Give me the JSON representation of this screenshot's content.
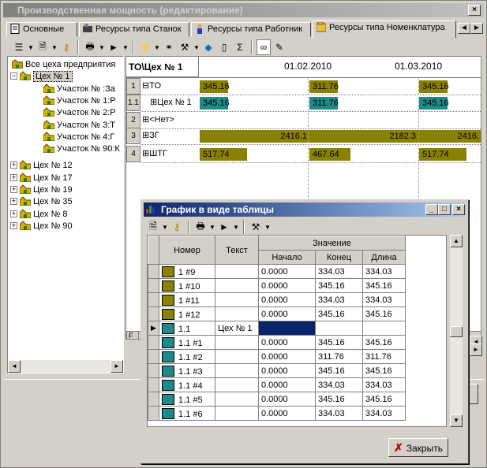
{
  "main_window": {
    "title": "Производственная мощность (редактирование)",
    "close": "×"
  },
  "tabs": [
    {
      "label": "Основные",
      "icon": "document-icon"
    },
    {
      "label": "Ресурсы типа Станок",
      "icon": "machine-icon"
    },
    {
      "label": "Ресурсы типа Работник",
      "icon": "worker-icon"
    },
    {
      "label": "Ресурсы типа Номенклатура",
      "icon": "nomenclature-icon"
    }
  ],
  "tree": {
    "root": "Все цеха предприятия",
    "items": [
      {
        "label": "Цех № 1",
        "selected": true,
        "expanded": true
      },
      {
        "label": "Участок № :За"
      },
      {
        "label": "Участок № 1:Р"
      },
      {
        "label": "Участок № 2:Р"
      },
      {
        "label": "Участок № 3:Т"
      },
      {
        "label": "Участок № 4:Г"
      },
      {
        "label": "Участок № 90:К"
      },
      {
        "label": "Цех № 12"
      },
      {
        "label": "Цех № 17"
      },
      {
        "label": "Цех № 19"
      },
      {
        "label": "Цех № 35"
      },
      {
        "label": "Цех № 8"
      },
      {
        "label": "Цех № 90"
      }
    ]
  },
  "gantt": {
    "header_label": "ТО\\Цех № 1",
    "dates": [
      "01.02.2010",
      "01.03.2010"
    ],
    "rows": [
      {
        "num": "1",
        "label": "ТО",
        "values": [
          "345.16",
          "311.76",
          "345.16"
        ]
      },
      {
        "num": "1.1",
        "label": "Цех № 1",
        "values": [
          "345.16",
          "311.76",
          "345.16"
        ]
      },
      {
        "num": "2",
        "label": "<Нет>",
        "values": []
      },
      {
        "num": "3",
        "label": "ЗГ",
        "values": [
          "2416.1",
          "2182.3",
          "2416."
        ]
      },
      {
        "num": "4",
        "label": "ШТГ",
        "values": [
          "517.74",
          "467.64",
          "517.74"
        ]
      }
    ],
    "colors": {
      "olive": "#8b8100",
      "teal": "#1e8a8a"
    },
    "tab_stub": "F"
  },
  "dialog": {
    "title": "График в виде таблицы",
    "columns": {
      "num": "Номер",
      "text": "Текст",
      "value_group": "Значение",
      "start": "Начало",
      "end": "Конец",
      "length": "Длина"
    },
    "rows": [
      {
        "num": "1 #9",
        "text": "",
        "start": "0.0000",
        "end": "334.03",
        "len": "334.03",
        "color": "#8b8100"
      },
      {
        "num": "1 #10",
        "text": "",
        "start": "0.0000",
        "end": "345.16",
        "len": "345.16",
        "color": "#8b8100"
      },
      {
        "num": "1 #11",
        "text": "",
        "start": "0.0000",
        "end": "334.03",
        "len": "334.03",
        "color": "#8b8100"
      },
      {
        "num": "1 #12",
        "text": "",
        "start": "0.0000",
        "end": "345.16",
        "len": "345.16",
        "color": "#8b8100"
      },
      {
        "num": "1.1",
        "text": "Цех № 1",
        "start": "",
        "end": "",
        "len": "",
        "color": "#1e8a8a",
        "current": true
      },
      {
        "num": "1.1 #1",
        "text": "",
        "start": "0.0000",
        "end": "345.16",
        "len": "345.16",
        "color": "#1e8a8a"
      },
      {
        "num": "1.1 #2",
        "text": "",
        "start": "0.0000",
        "end": "311.76",
        "len": "311.76",
        "color": "#1e8a8a"
      },
      {
        "num": "1.1 #3",
        "text": "",
        "start": "0.0000",
        "end": "345.16",
        "len": "345.16",
        "color": "#1e8a8a"
      },
      {
        "num": "1.1 #4",
        "text": "",
        "start": "0.0000",
        "end": "334.03",
        "len": "334.03",
        "color": "#1e8a8a"
      },
      {
        "num": "1.1 #5",
        "text": "",
        "start": "0.0000",
        "end": "345.16",
        "len": "345.16",
        "color": "#1e8a8a"
      },
      {
        "num": "1.1 #6",
        "text": "",
        "start": "0.0000",
        "end": "334.03",
        "len": "334.03",
        "color": "#1e8a8a"
      }
    ],
    "close_button": "Закрыть"
  }
}
